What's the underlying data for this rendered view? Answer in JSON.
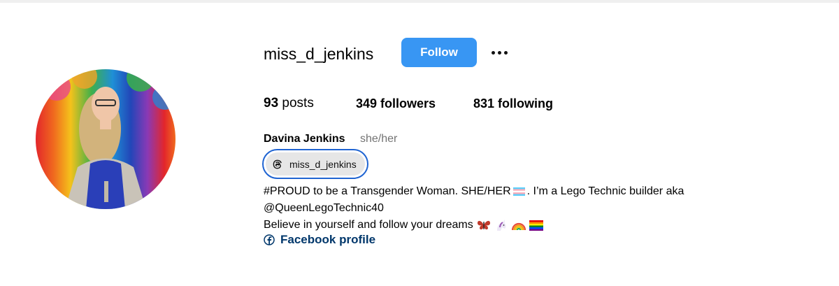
{
  "profile": {
    "username": "miss_d_jenkins",
    "follow_label": "Follow",
    "more_icon": "more-options-icon",
    "stats": {
      "posts_count": "93",
      "posts_label": " posts",
      "followers_count": "349",
      "followers_label": " followers",
      "following_count": "831",
      "following_label": " following"
    },
    "full_name": "Davina Jenkins",
    "pronouns": "she/her",
    "threads_handle": "miss_d_jenkins",
    "bio": {
      "line1_a": "#PROUD to be a Transgender Woman. SHE/HER",
      "line1_b": ". I’m a Lego Technic builder aka",
      "line2": "@QueenLegoTechnic40",
      "line3": "Believe in yourself and follow your dreams"
    },
    "facebook_label": "Facebook profile"
  },
  "colors": {
    "follow_bg": "#3896f3",
    "link": "#00376b",
    "threads_border": "#1f64d2"
  }
}
